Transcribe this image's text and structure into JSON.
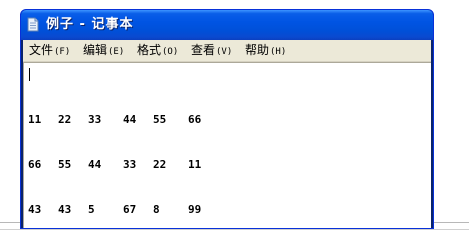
{
  "window": {
    "title": "例子 - 记事本"
  },
  "menu": [
    {
      "label": "文件",
      "key": "(F)"
    },
    {
      "label": "编辑",
      "key": "(E)"
    },
    {
      "label": "格式",
      "key": "(O)"
    },
    {
      "label": "查看",
      "key": "(V)"
    },
    {
      "label": "帮助",
      "key": "(H)"
    }
  ],
  "document": {
    "rows": [
      [
        "11",
        "22",
        "33",
        "44",
        "55",
        "66"
      ],
      [
        "66",
        "55",
        "44",
        "33",
        "22",
        "11"
      ],
      [
        "43",
        "43",
        "5",
        "67",
        "8",
        "99"
      ]
    ]
  },
  "icons": {
    "title_icon": "notepad-icon"
  },
  "colors": {
    "titlebar": "#0054e3",
    "menubar": "#ece9d8",
    "text": "#000000"
  }
}
